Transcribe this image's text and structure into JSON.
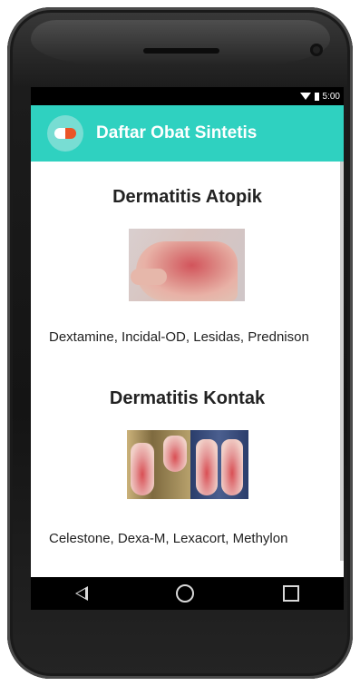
{
  "status_bar": {
    "time": "5:00"
  },
  "app_bar": {
    "title": "Daftar Obat Sintetis",
    "accent_color": "#2fd1c0",
    "icon": "pill-icon"
  },
  "sections": [
    {
      "title": "Dermatitis Atopik",
      "medications": "Dextamine, Incidal-OD, Lesidas, Prednison",
      "image": "atopic-dermatitis-hand-photo"
    },
    {
      "title": "Dermatitis Kontak",
      "medications": "Celestone, Dexa-M, Lexacort, Methylon",
      "image": "contact-dermatitis-feet-photo"
    }
  ],
  "nav_bar": {
    "icons": [
      "back-icon",
      "home-icon",
      "recent-apps-icon"
    ]
  }
}
